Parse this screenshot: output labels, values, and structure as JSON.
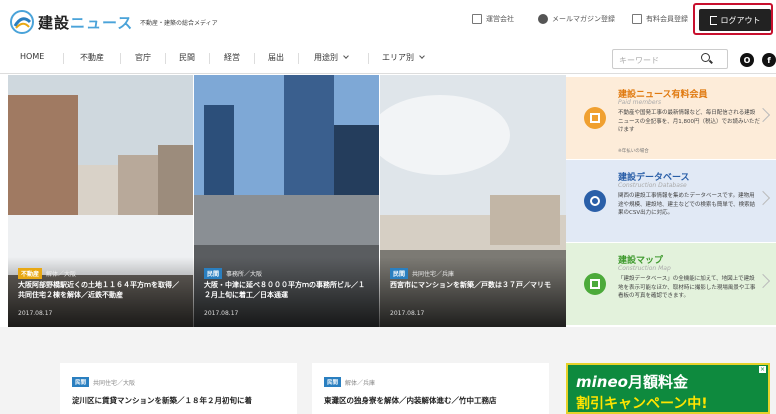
{
  "header": {
    "logo_jp": "建設",
    "logo_accent": "ニュース",
    "tagline": "不動産・建築の総合メディア",
    "util_links": [
      "運営会社",
      "メールマガジン登録",
      "有料会員登録"
    ],
    "logout_label": "ログアウト"
  },
  "nav": {
    "items": [
      "HOME",
      "不動産",
      "官庁",
      "民間",
      "経営",
      "届出",
      "用途別",
      "エリア別"
    ],
    "search_placeholder": "キーワード",
    "social": [
      "O",
      "f"
    ]
  },
  "hero": [
    {
      "tag": "不動産",
      "tag_color": "#e8a814",
      "category": "解体／大阪",
      "title": "大阪阿部野橋駅近くの土地１１６４平方ｍを取得／共同住宅２棟を解体／近鉄不動産",
      "date": "2017.08.17"
    },
    {
      "tag": "民間",
      "tag_color": "#2a7fc0",
      "category": "事務所／大阪",
      "title": "大阪・中津に延べ８０００平方ｍの事務所ビル／１２月上旬に着工／日本通運",
      "date": "2017.08.17"
    },
    {
      "tag": "民間",
      "tag_color": "#2a7fc0",
      "category": "共同住宅／兵庫",
      "title": "西宮市にマンションを新築／戸数は３７戸／マリモ",
      "date": "2017.08.17"
    }
  ],
  "cards": [
    {
      "title": "建設ニュース有料会員",
      "subtitle": "Paid members",
      "desc": "不動産や国発工事の最新情報など、毎日配信される建設ニュースの全記事を、月1,800円（税込）でお読みいただけます",
      "note": "※年払いの場合",
      "bg": "#fdecd9",
      "title_color": "#e07a10",
      "icon": "document-icon",
      "icon_color": "#f0a030"
    },
    {
      "title": "建設データベース",
      "subtitle": "Construction Database",
      "desc": "関西の建設工事情報を集めたデータベースです。建物用途や規模、建設地、建主などでの検索も簡単で、検索結果のCSV出力に対応。",
      "note": "",
      "bg": "#e1e9f5",
      "title_color": "#2a5fa8",
      "icon": "database-icon",
      "icon_color": "#2a5fa8"
    },
    {
      "title": "建設マップ",
      "subtitle": "Construction Map",
      "desc": "「建設データベース」の全機能に加えて、地図上で建設地を表示可能なほか、取材時に撮影した現場風景や工事看板の写真を確認できます。",
      "note": "",
      "bg": "#e3f2dc",
      "title_color": "#3f9a2e",
      "icon": "map-icon",
      "icon_color": "#4caa3a"
    }
  ],
  "news": [
    {
      "tag": "民間",
      "category": "共同住宅／大阪",
      "title": "淀川区に賃貸マンションを新築／１８年２月初旬に着"
    },
    {
      "tag": "民間",
      "category": "解体／兵庫",
      "title": "東灘区の独身寮を解体／内装解体進む／竹中工務店"
    }
  ],
  "ad": {
    "brand": "mineo",
    "line1": "月額料金",
    "line2": "割引キャンペーン中!",
    "close": "×"
  }
}
